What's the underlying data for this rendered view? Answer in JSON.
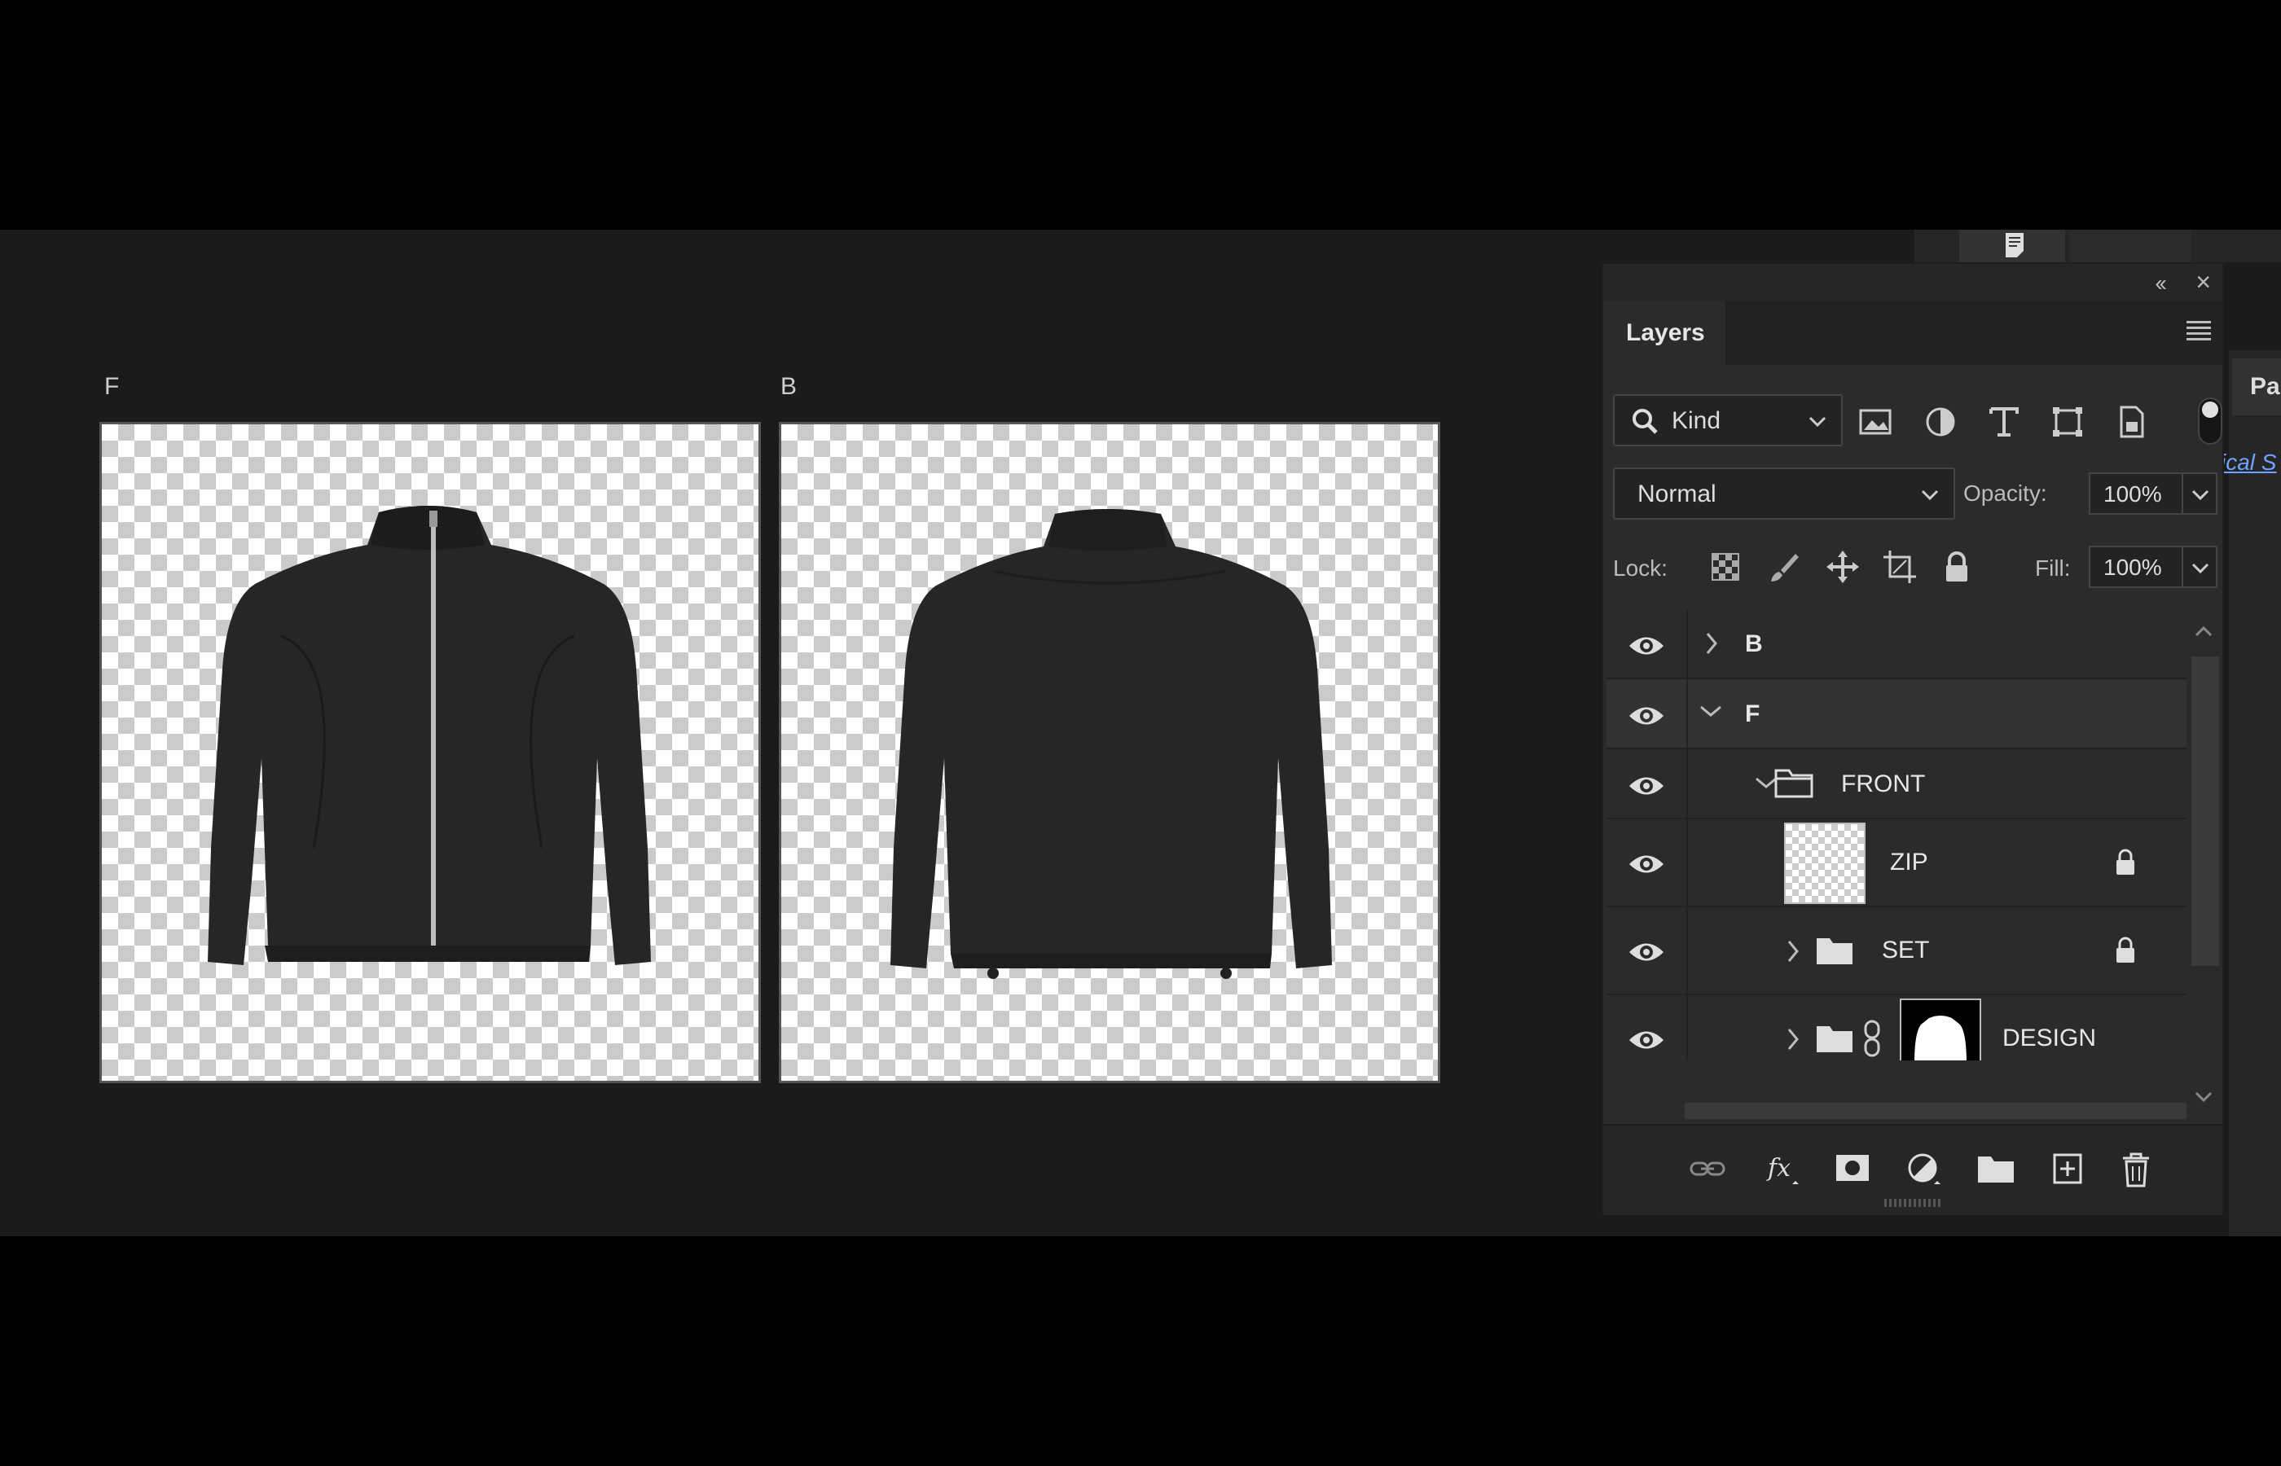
{
  "canvas": {
    "artboards": [
      {
        "label": "F",
        "content": "jacket-front"
      },
      {
        "label": "B",
        "content": "jacket-back"
      }
    ]
  },
  "right_dock": {
    "tab_label": "Pa",
    "link_text": "ical S"
  },
  "layers_panel": {
    "tab_label": "Layers",
    "filter": {
      "kind_label": "Kind"
    },
    "blend_mode": "Normal",
    "opacity_label": "Opacity:",
    "opacity_value": "100%",
    "lock_label": "Lock:",
    "fill_label": "Fill:",
    "fill_value": "100%",
    "layers": [
      {
        "name": "B",
        "type": "artboard",
        "expanded": false
      },
      {
        "name": "F",
        "type": "artboard",
        "expanded": true
      },
      {
        "name": "FRONT",
        "type": "group",
        "expanded": true
      },
      {
        "name": "ZIP",
        "type": "layer",
        "locked": true
      },
      {
        "name": "SET",
        "type": "group",
        "locked": true
      },
      {
        "name": "DESIGN",
        "type": "group-with-mask"
      }
    ]
  },
  "colors": {
    "workspace_bg": "#1b1b1b",
    "panel_bg": "#2b2b2b",
    "selected_row": "#333333",
    "link": "#6fa3ff"
  }
}
